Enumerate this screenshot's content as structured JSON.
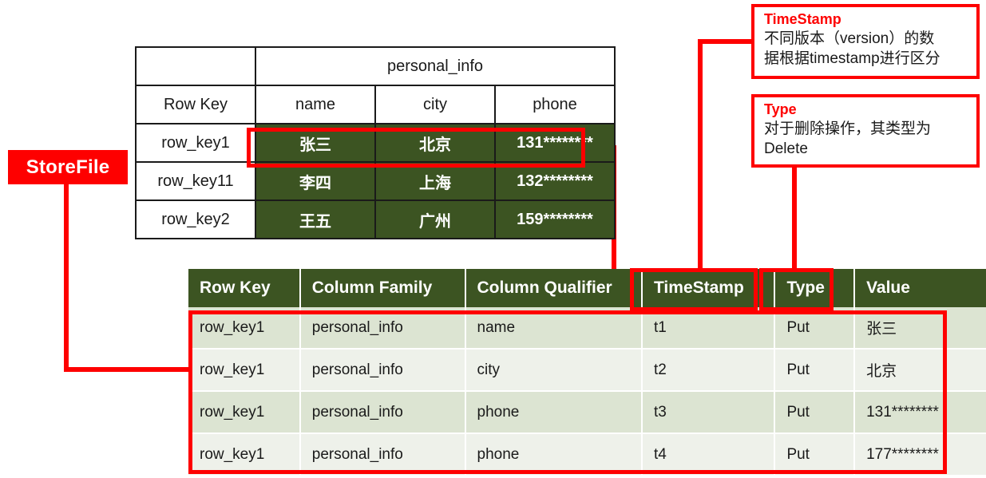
{
  "colors": {
    "accent_red": "#fe0000",
    "header_green": "#3c5422",
    "row_odd": "#dce4d2",
    "row_even": "#eef1ea",
    "text_dark": "#1a1a1a"
  },
  "storefile": {
    "label": "StoreFile"
  },
  "logical_table": {
    "column_family": "personal_info",
    "row_key_header": "Row Key",
    "qualifiers": [
      "name",
      "city",
      "phone"
    ],
    "rows": [
      {
        "row_key": "row_key1",
        "name": "张三",
        "city": "北京",
        "phone": "131********"
      },
      {
        "row_key": "row_key11",
        "name": "李四",
        "city": "上海",
        "phone": "132********"
      },
      {
        "row_key": "row_key2",
        "name": "王五",
        "city": "广州",
        "phone": "159********"
      }
    ]
  },
  "kv_table": {
    "headers": [
      "Row Key",
      "Column Family",
      "Column Qualifier",
      "TimeStamp",
      "Type",
      "Value"
    ],
    "rows": [
      {
        "row_key": "row_key1",
        "column_family": "personal_info",
        "column_qualifier": "name",
        "timestamp": "t1",
        "type": "Put",
        "value": "张三"
      },
      {
        "row_key": "row_key1",
        "column_family": "personal_info",
        "column_qualifier": "city",
        "timestamp": "t2",
        "type": "Put",
        "value": "北京"
      },
      {
        "row_key": "row_key1",
        "column_family": "personal_info",
        "column_qualifier": "phone",
        "timestamp": "t3",
        "type": "Put",
        "value": "131********"
      },
      {
        "row_key": "row_key1",
        "column_family": "personal_info",
        "column_qualifier": "phone",
        "timestamp": "t4",
        "type": "Put",
        "value": "177********"
      }
    ]
  },
  "callouts": {
    "timestamp": {
      "title": "TimeStamp",
      "body": "不同版本（version）的数\n据根据timestamp进行区分"
    },
    "type": {
      "title": "Type",
      "body": "对于删除操作，其类型为\nDelete"
    }
  }
}
